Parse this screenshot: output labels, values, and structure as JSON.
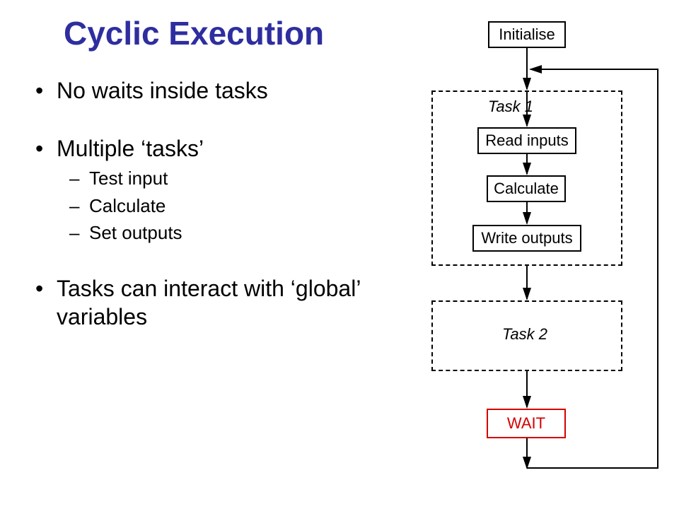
{
  "title": "Cyclic Execution",
  "bullets": {
    "b1": "No waits inside tasks",
    "b2": "Multiple ‘tasks’",
    "b2_1": "Test input",
    "b2_2": "Calculate",
    "b2_3": "Set outputs",
    "b3": "Tasks can interact with ‘global’ variables"
  },
  "diagram": {
    "initialise": "Initialise",
    "task1_label": "Task 1",
    "read_inputs": "Read inputs",
    "calculate": "Calculate",
    "write_outputs": "Write outputs",
    "task2_label": "Task 2",
    "wait": "WAIT"
  },
  "chart_data": {
    "type": "diagram",
    "title": "Cyclic Execution Flowchart",
    "nodes": [
      {
        "id": "initialise",
        "label": "Initialise",
        "type": "process"
      },
      {
        "id": "task1",
        "label": "Task 1",
        "type": "group",
        "children": [
          "read_inputs",
          "calculate",
          "write_outputs"
        ]
      },
      {
        "id": "read_inputs",
        "label": "Read inputs",
        "type": "process"
      },
      {
        "id": "calculate",
        "label": "Calculate",
        "type": "process"
      },
      {
        "id": "write_outputs",
        "label": "Write outputs",
        "type": "process"
      },
      {
        "id": "task2",
        "label": "Task 2",
        "type": "group"
      },
      {
        "id": "wait",
        "label": "WAIT",
        "type": "wait"
      }
    ],
    "edges": [
      {
        "from": "initialise",
        "to": "read_inputs"
      },
      {
        "from": "read_inputs",
        "to": "calculate"
      },
      {
        "from": "calculate",
        "to": "write_outputs"
      },
      {
        "from": "write_outputs",
        "to": "task2"
      },
      {
        "from": "task2",
        "to": "wait"
      },
      {
        "from": "wait",
        "to": "read_inputs",
        "note": "loop back to top of Task 1"
      }
    ]
  }
}
